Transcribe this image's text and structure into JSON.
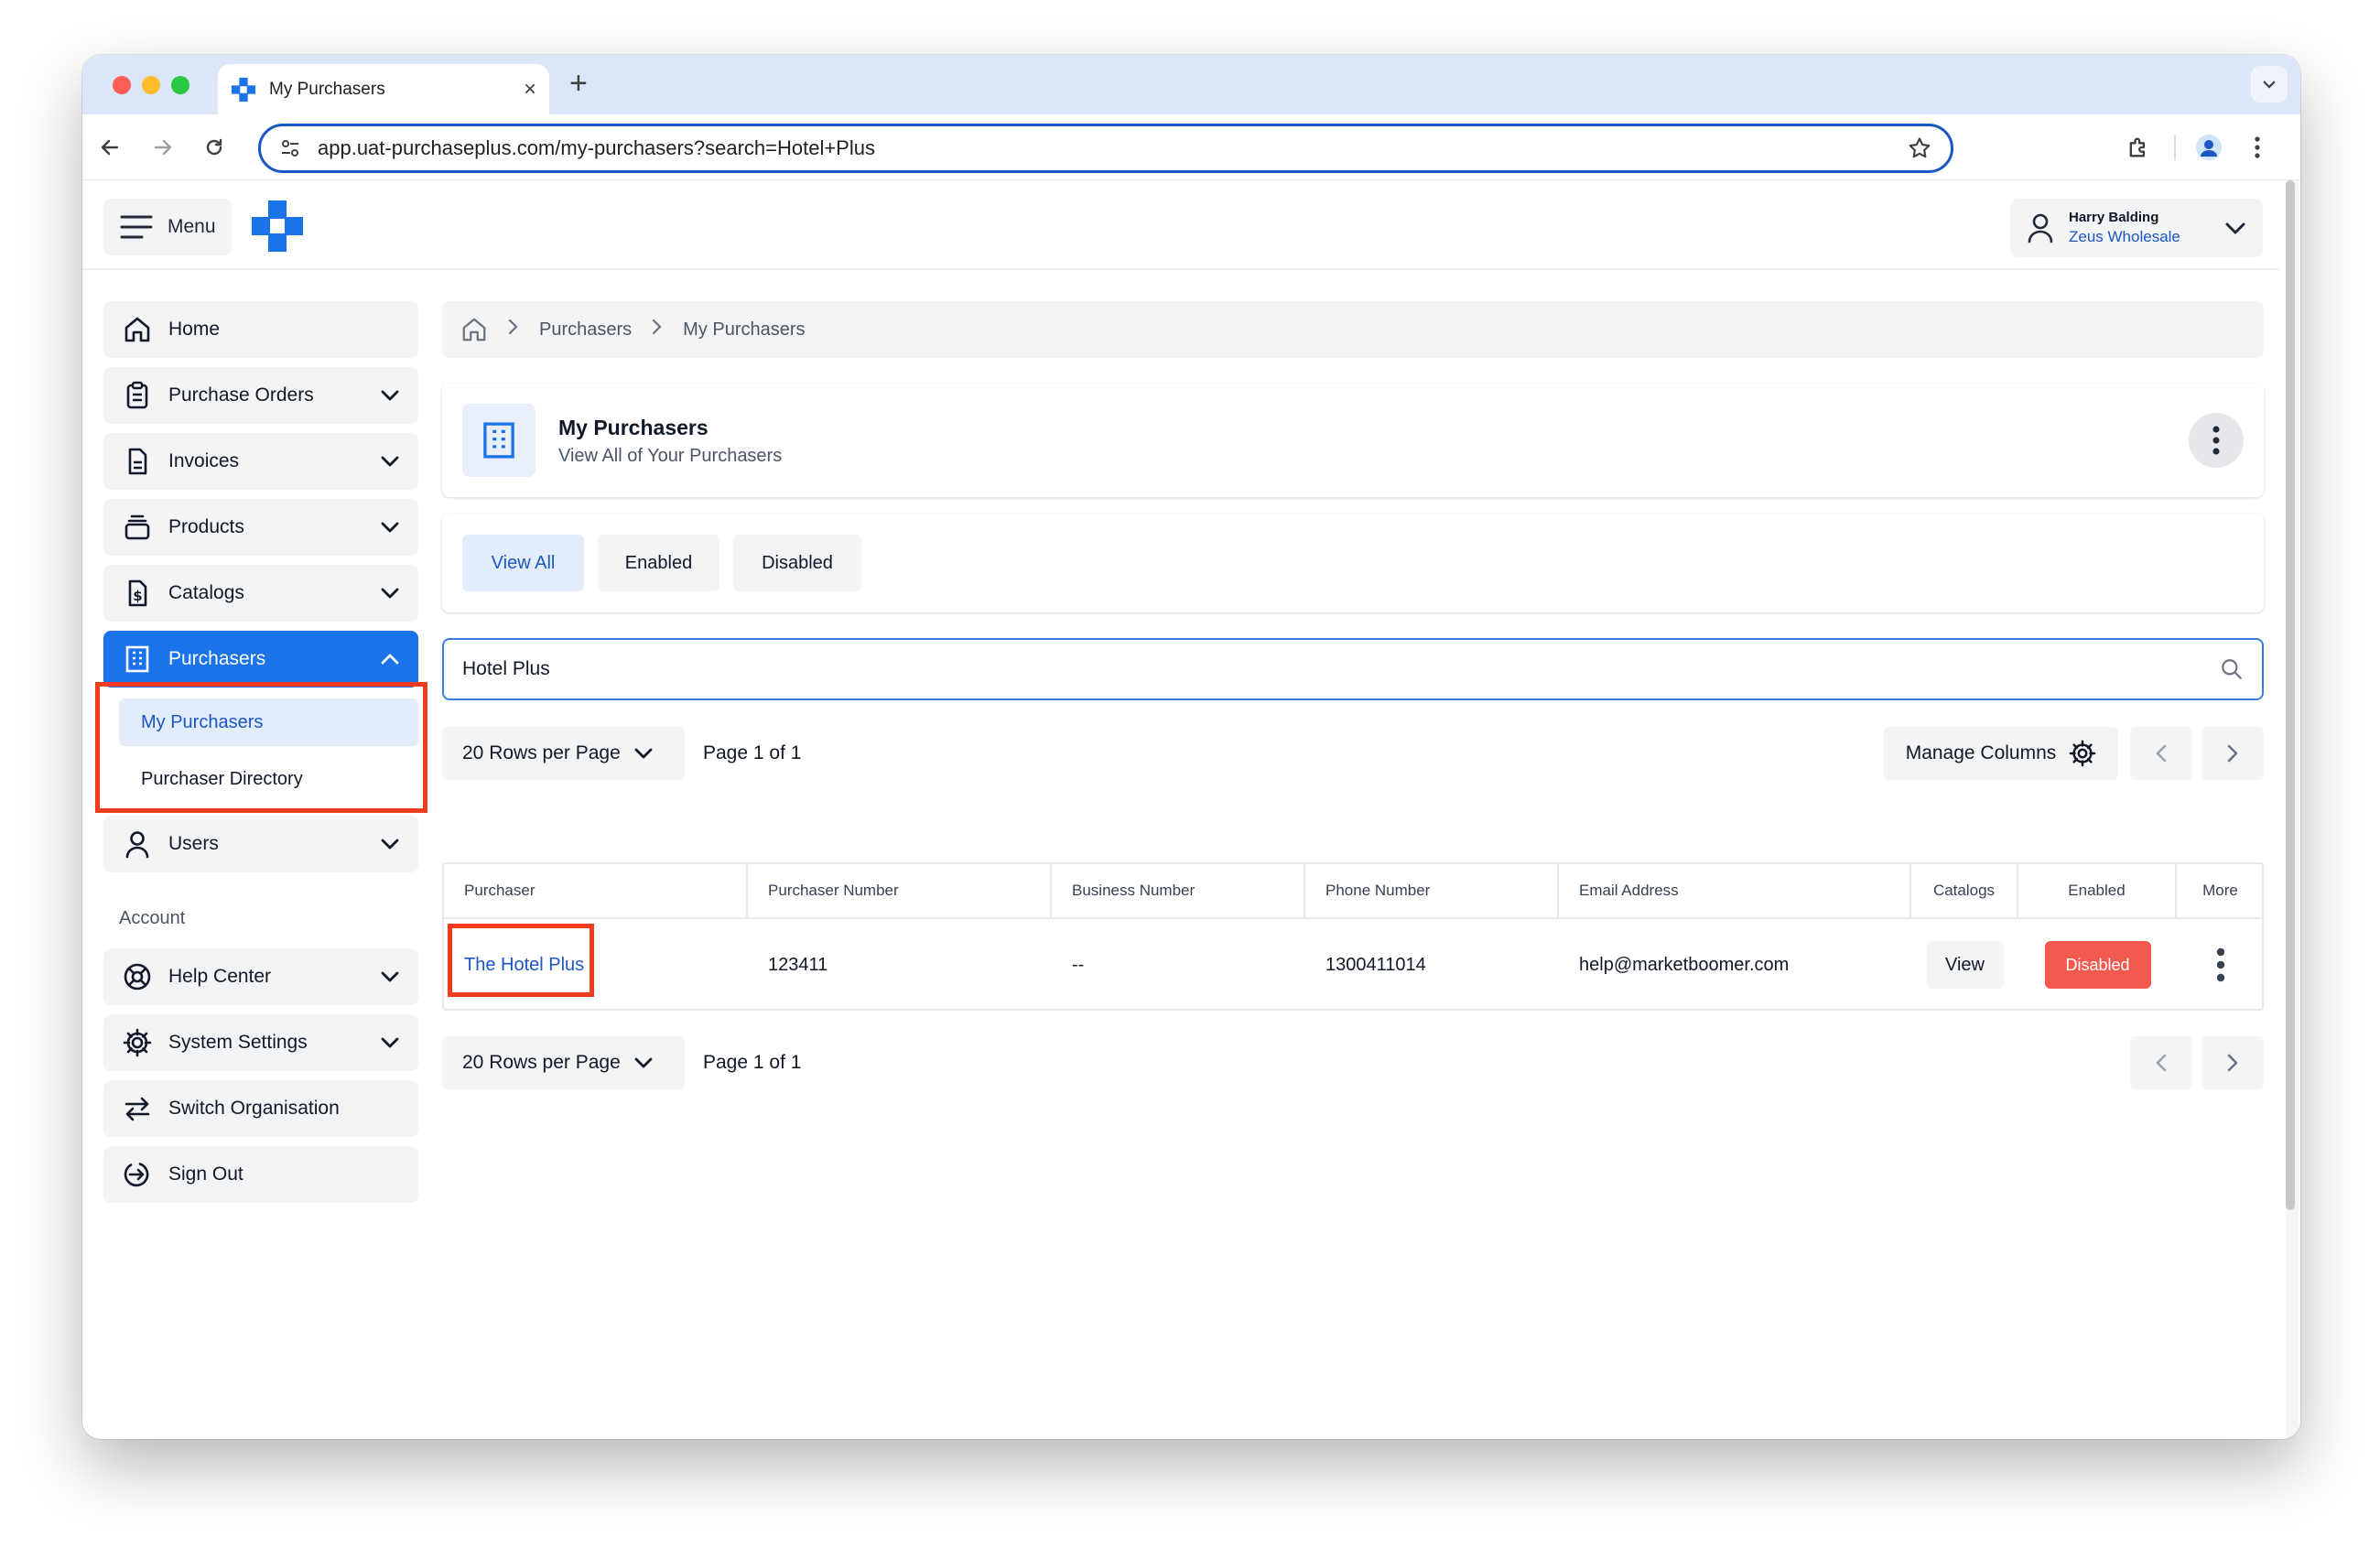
{
  "browser": {
    "tab_title": "My Purchasers",
    "url": "app.uat-purchaseplus.com/my-purchasers?search=Hotel+Plus"
  },
  "header": {
    "menu_label": "Menu",
    "user_name": "Harry Balding",
    "user_org": "Zeus Wholesale"
  },
  "sidebar": {
    "home": "Home",
    "purchase_orders": "Purchase Orders",
    "invoices": "Invoices",
    "products": "Products",
    "catalogs": "Catalogs",
    "purchasers": "Purchasers",
    "my_purchasers": "My Purchasers",
    "purchaser_directory": "Purchaser Directory",
    "users": "Users",
    "account_label": "Account",
    "help_center": "Help Center",
    "system_settings": "System Settings",
    "switch_org": "Switch Organisation",
    "sign_out": "Sign Out"
  },
  "breadcrumb": {
    "level1": "Purchasers",
    "level2": "My Purchasers"
  },
  "page": {
    "title": "My Purchasers",
    "subtitle": "View All of Your Purchasers"
  },
  "filters": {
    "view_all": "View All",
    "enabled": "Enabled",
    "disabled": "Disabled"
  },
  "search": {
    "value": "Hotel Plus"
  },
  "pagination": {
    "rows_per_page": "20 Rows per Page",
    "page_info": "Page 1 of 1"
  },
  "manage_columns": "Manage Columns",
  "table": {
    "columns": {
      "purchaser": "Purchaser",
      "purchaser_number": "Purchaser Number",
      "business_number": "Business Number",
      "phone_number": "Phone Number",
      "email_address": "Email Address",
      "catalogs": "Catalogs",
      "enabled": "Enabled",
      "more": "More"
    },
    "rows": [
      {
        "purchaser": "The Hotel Plus",
        "purchaser_number": "123411",
        "business_number": "--",
        "phone_number": "1300411014",
        "email_address": "help@marketboomer.com",
        "catalogs_action": "View",
        "status": "Disabled"
      }
    ]
  },
  "colors": {
    "primary": "#1a73e8",
    "link": "#1a56c4",
    "status_disabled": "#f25a4f",
    "highlight": "#f03c1e"
  }
}
